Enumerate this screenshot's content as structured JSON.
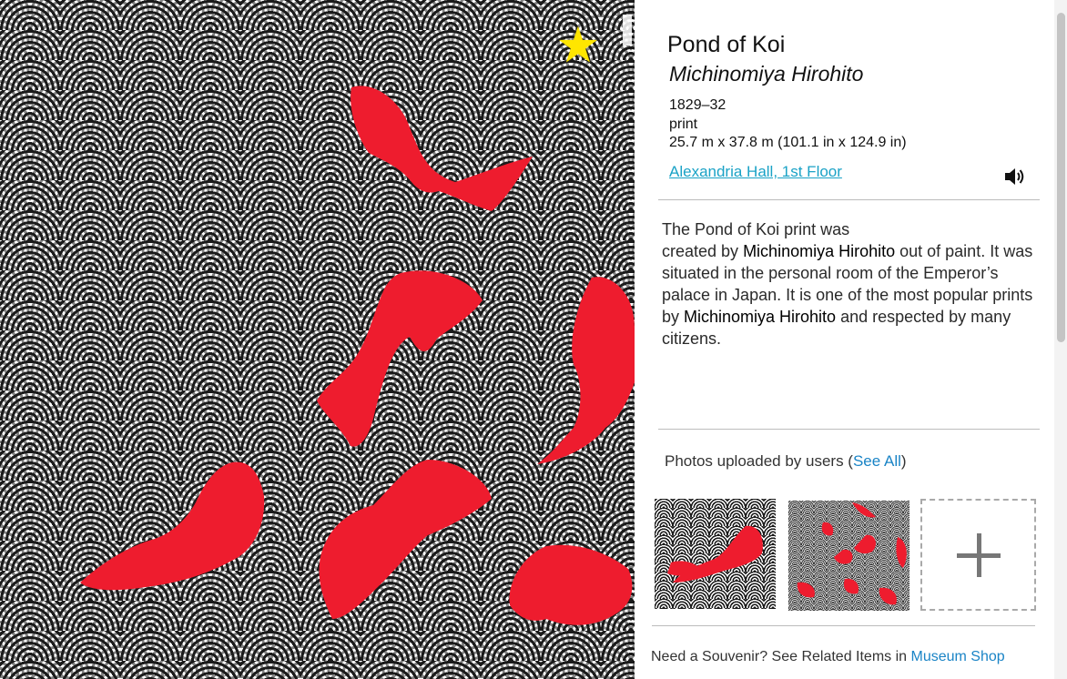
{
  "artwork": {
    "image_label": "koi-pond-artwork",
    "favorite_icon": "star-icon",
    "colors": {
      "koi": "#ee1c2e",
      "wave_dark": "#1b1b1b",
      "star": "#ffe600"
    }
  },
  "details": {
    "title": "Pond of Koi",
    "artist": "Michinomiya Hirohito",
    "date": "1829–32",
    "medium": "print",
    "dimensions": "25.7 m x 37.8 m (101.1 in x 124.9 in)",
    "location": "Alexandria Hall, 1st Floor",
    "audio_icon": "speaker-icon"
  },
  "description": {
    "part1": "The Pond of Koi print was",
    "part2": "created by ",
    "artist_1": "Michinomiya Hirohito",
    "part3": " out of paint. It was situated in the personal room of the Emperor’s palace in Japan. It is one of the most popular prints by ",
    "artist_2": "Michinomiya Hirohito",
    "part4": " and respected by many citizens."
  },
  "photos": {
    "heading": "Photos uploaded by users (",
    "see_all": "See All",
    "heading_close": ")",
    "add_icon": "plus-icon"
  },
  "souvenir": {
    "text": "Need a Souvenir? See Related Items in ",
    "link": "Museum Shop"
  },
  "link_color": "#1a84c6",
  "location_color": "#1aa2c6"
}
